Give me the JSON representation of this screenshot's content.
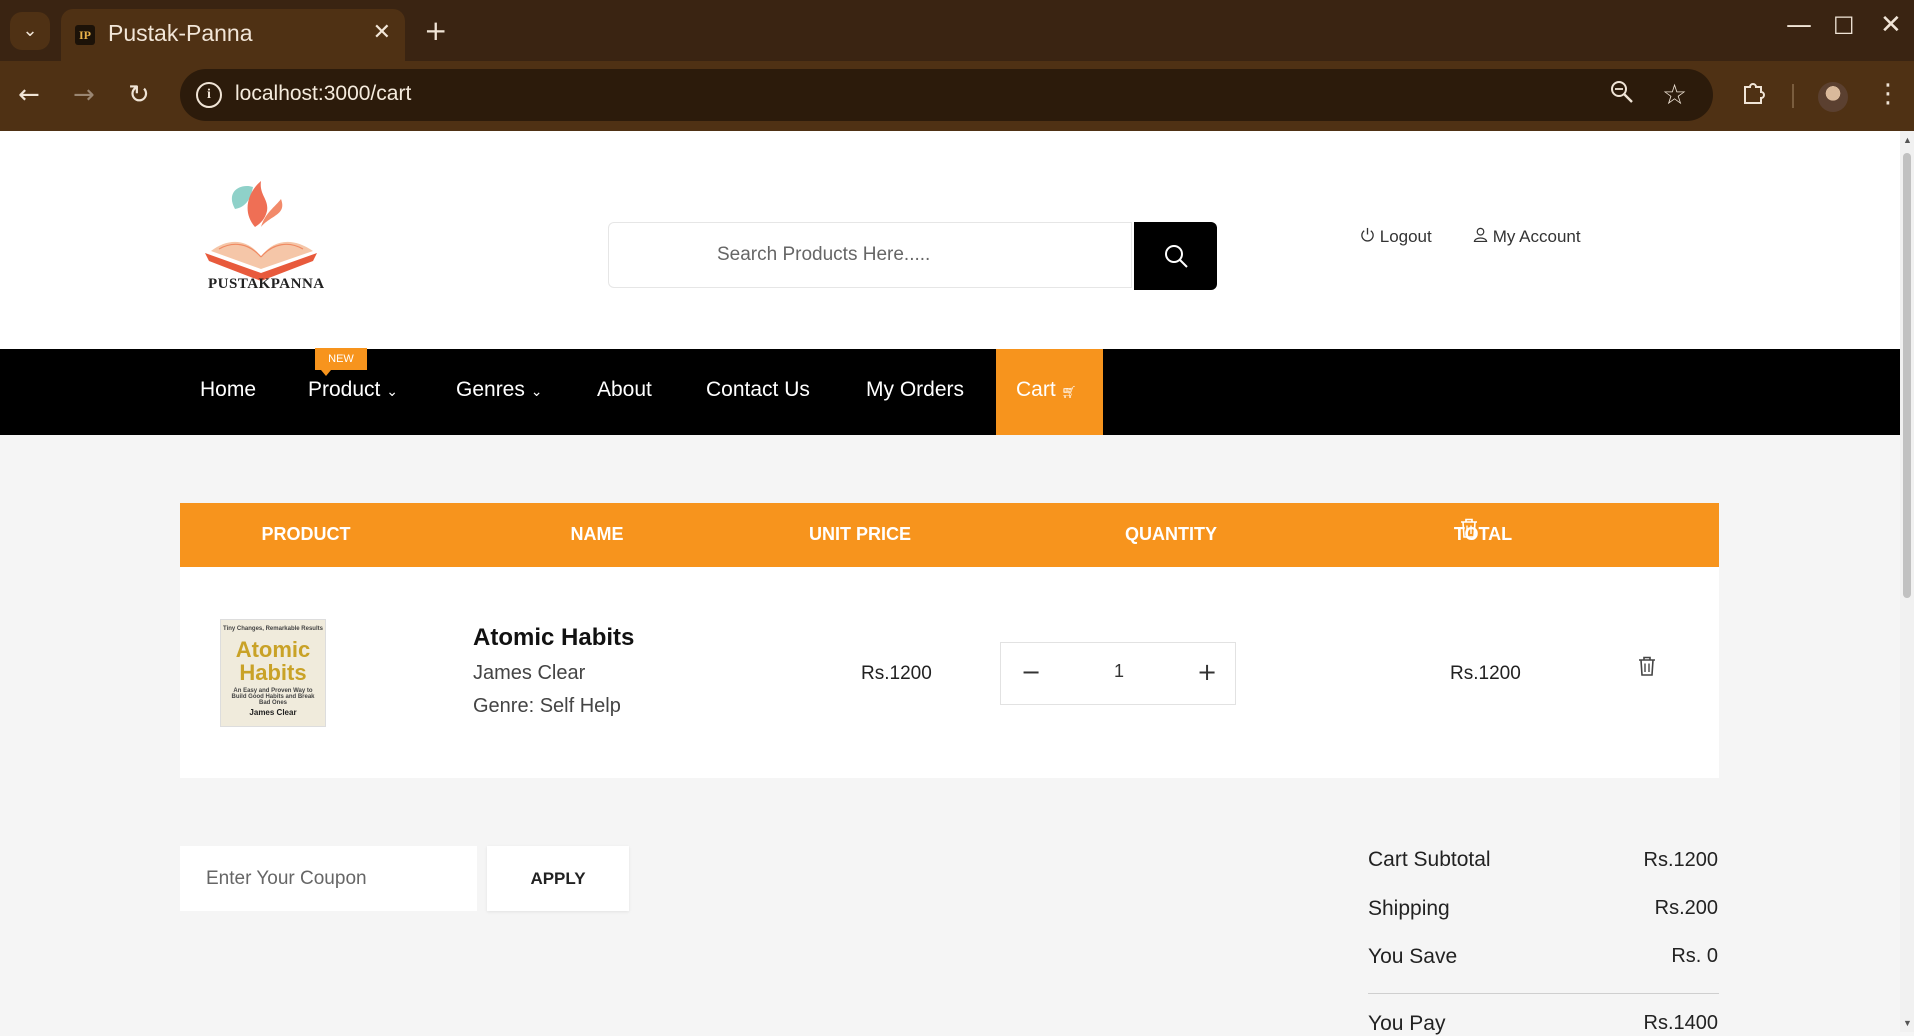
{
  "browser": {
    "tab_title": "Pustak-Panna",
    "tab_favicon": "IP",
    "url": "localhost:3000/cart",
    "icons": {
      "tabs_dropdown": "chevron-down-icon",
      "tab_close": "close-icon",
      "new_tab": "plus-icon",
      "minimize": "minimize-icon",
      "maximize": "maximize-icon",
      "close": "close-icon",
      "back": "back-arrow-icon",
      "forward": "forward-arrow-icon",
      "reload": "reload-icon",
      "site_info": "info-icon",
      "zoom": "zoom-icon",
      "bookmark": "star-icon",
      "extensions": "puzzle-icon",
      "profile": "avatar",
      "menu": "more-vert-icon"
    }
  },
  "header": {
    "logo_text": "PUSTAKPANNA",
    "search_placeholder": "Search Products Here.....",
    "logout_label": "Logout",
    "account_label": "My Account"
  },
  "nav": {
    "items": [
      {
        "label": "Home"
      },
      {
        "label": "Product"
      },
      {
        "label": "Genres"
      },
      {
        "label": "About"
      },
      {
        "label": "Contact Us"
      },
      {
        "label": "My Orders"
      }
    ],
    "new_badge": "NEW",
    "cart_label": "Cart"
  },
  "cart": {
    "columns": [
      "PRODUCT",
      "NAME",
      "UNIT PRICE",
      "QUANTITY",
      "TOTAL"
    ],
    "items": [
      {
        "cover": {
          "top_text": "Tiny Changes, Remarkable Results",
          "title_line1": "Atomic",
          "title_line2": "Habits",
          "subtitle": "An Easy and Proven Way to Build Good Habits and Break Bad Ones",
          "author": "James Clear"
        },
        "title": "Atomic Habits",
        "author": "James Clear",
        "genre": "Genre: Self Help",
        "unit_price": "Rs.1200",
        "quantity": "1",
        "total": "Rs.1200"
      }
    ]
  },
  "coupon": {
    "placeholder": "Enter Your Coupon",
    "apply_label": "APPLY"
  },
  "summary": {
    "subtotal_label": "Cart Subtotal",
    "subtotal_value": "Rs.1200",
    "shipping_label": "Shipping",
    "shipping_value": "Rs.200",
    "save_label": "You Save",
    "save_value": "Rs. 0",
    "pay_label": "You Pay",
    "pay_value": "Rs.1400"
  },
  "colors": {
    "accent": "#f7941d",
    "navbar": "#000000",
    "chrome_frame": "#3a2412",
    "chrome_toolbar": "#4f3114"
  }
}
